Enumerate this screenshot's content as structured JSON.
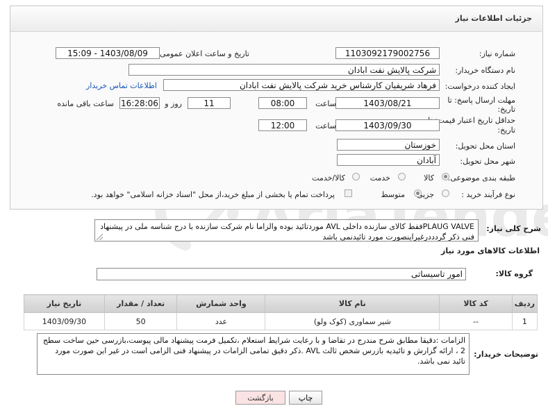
{
  "page_title": "جزئیات اطلاعات نیاز",
  "fields": {
    "need_number_label": "شماره نیاز:",
    "need_number": "1103092179002756",
    "announce_label": "تاریخ و ساعت اعلان عمومی:",
    "announce_value": "1403/08/09 - 15:09",
    "buyer_org_label": "نام دستگاه خریدار:",
    "buyer_org": "شرکت پالایش نفت ابادان",
    "creator_label": "ایجاد کننده درخواست:",
    "creator": "فرهاد شریفیان کارشناس خرید شرکت پالایش نفت ابادان",
    "contact_link": "اطلاعات تماس خریدار",
    "reply_deadline_label_1": "مهلت ارسال پاسخ: تا",
    "reply_deadline_label_2": "تاریخ:",
    "reply_date": "1403/08/21",
    "time_label": "ساعت",
    "reply_time": "08:00",
    "days_value": "11",
    "days_label": "روز و",
    "remaining_time": "16:28:06",
    "remaining_label": "ساعت باقی مانده",
    "price_validity_label_1": "حداقل تاریخ اعتبار قیمت: تا",
    "price_validity_label_2": "تاریخ:",
    "validity_date": "1403/09/30",
    "validity_time": "12:00",
    "province_label": "استان محل تحویل:",
    "province": "خوزستان",
    "city_label": "شهر محل تحویل:",
    "city": "آبادان",
    "category_label": "طبقه بندی موضوعی:",
    "category_options": [
      "کالا",
      "خدمت",
      "کالا/خدمت"
    ],
    "purchase_type_label": "نوع فرآیند خرید :",
    "purchase_options": [
      "جزیی",
      "متوسط"
    ],
    "payment_note": "پرداخت تمام یا بخشی از مبلغ خرید،از محل \"اسناد خزانه اسلامی\" خواهد بود."
  },
  "summary": {
    "label": "شرح کلی نیاز:",
    "text": "PLAUG VALVEفقط کالای سازنده داخلی AVL موردتائید بوده والزاما نام شرکت سازنده با درج شناسه ملی در پیشنهاد فنی ذکر گردددرغیراینصورت مورد تائیدنمی باشد"
  },
  "goods_section": {
    "title": "اطلاعات کالاهای مورد نیاز",
    "group_label": "گروه کالا:",
    "group_value": "امور تاسیساتی"
  },
  "table": {
    "headers": [
      "ردیف",
      "کد کالا",
      "نام کالا",
      "واحد شمارش",
      "تعداد / مقدار",
      "تاریخ نیاز"
    ],
    "rows": [
      [
        "1",
        "--",
        "شیر سماوری (کوک ولو)",
        "عدد",
        "50",
        "1403/09/30"
      ]
    ]
  },
  "buyer_notes": {
    "label": "توضیحات خریدار:",
    "text": "الزامات :دقیقا مطابق شرح مندرج در تقاضا و با رعایت شرایط استعلام ،تکمیل فرمت پیشنهاد مالی پیوست،بازرسی حین ساخت سطح 2 ، ارائه گزارش و تائیدیه بازرس شخص ثالث AVL .ذکر دقیق تمامی الزامات در پیشنهاد فنی الزامی است در غیر این صورت مورد تائید نمی باشد."
  },
  "buttons": {
    "print": "چاپ",
    "back": "بازگشت"
  },
  "watermark": {
    "text": "AriaTender.neT"
  },
  "colors": {
    "link": "#1a56b5",
    "back_button_bg": "#fbe3e3",
    "watermark": "#e7e7e7"
  }
}
